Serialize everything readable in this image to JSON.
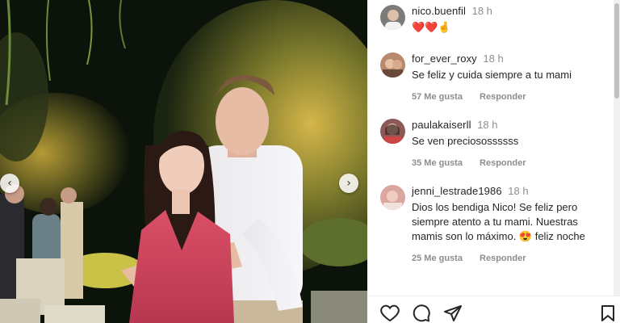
{
  "post": {
    "author": "nico.buenfil",
    "time": "18 h",
    "caption": "❤️❤️🤞"
  },
  "comments": [
    {
      "username": "for_ever_roxy",
      "time": "18 h",
      "text": "Se feliz y cuida siempre a tu mami",
      "likes": "57 Me gusta",
      "reply": "Responder"
    },
    {
      "username": "paulakaiserll",
      "time": "18 h",
      "text": "Se ven preciosossssss",
      "likes": "35 Me gusta",
      "reply": "Responder"
    },
    {
      "username": "jenni_lestrade1986",
      "time": "18 h",
      "text": "Dios los bendiga Nico! Se feliz pero siempre atento a tu mami. Nuestras mamis son lo máximo. 😍 feliz noche",
      "likes": "25 Me gusta",
      "reply": "Responder"
    }
  ],
  "icons": {
    "prev": "chevron-left-icon",
    "next": "chevron-right-icon",
    "like": "heart-icon",
    "comment": "comment-icon",
    "share": "send-icon",
    "save": "bookmark-icon"
  },
  "colors": {
    "text": "#262626",
    "muted": "#8e8e8e",
    "caption_heart": "#ed1c24"
  }
}
